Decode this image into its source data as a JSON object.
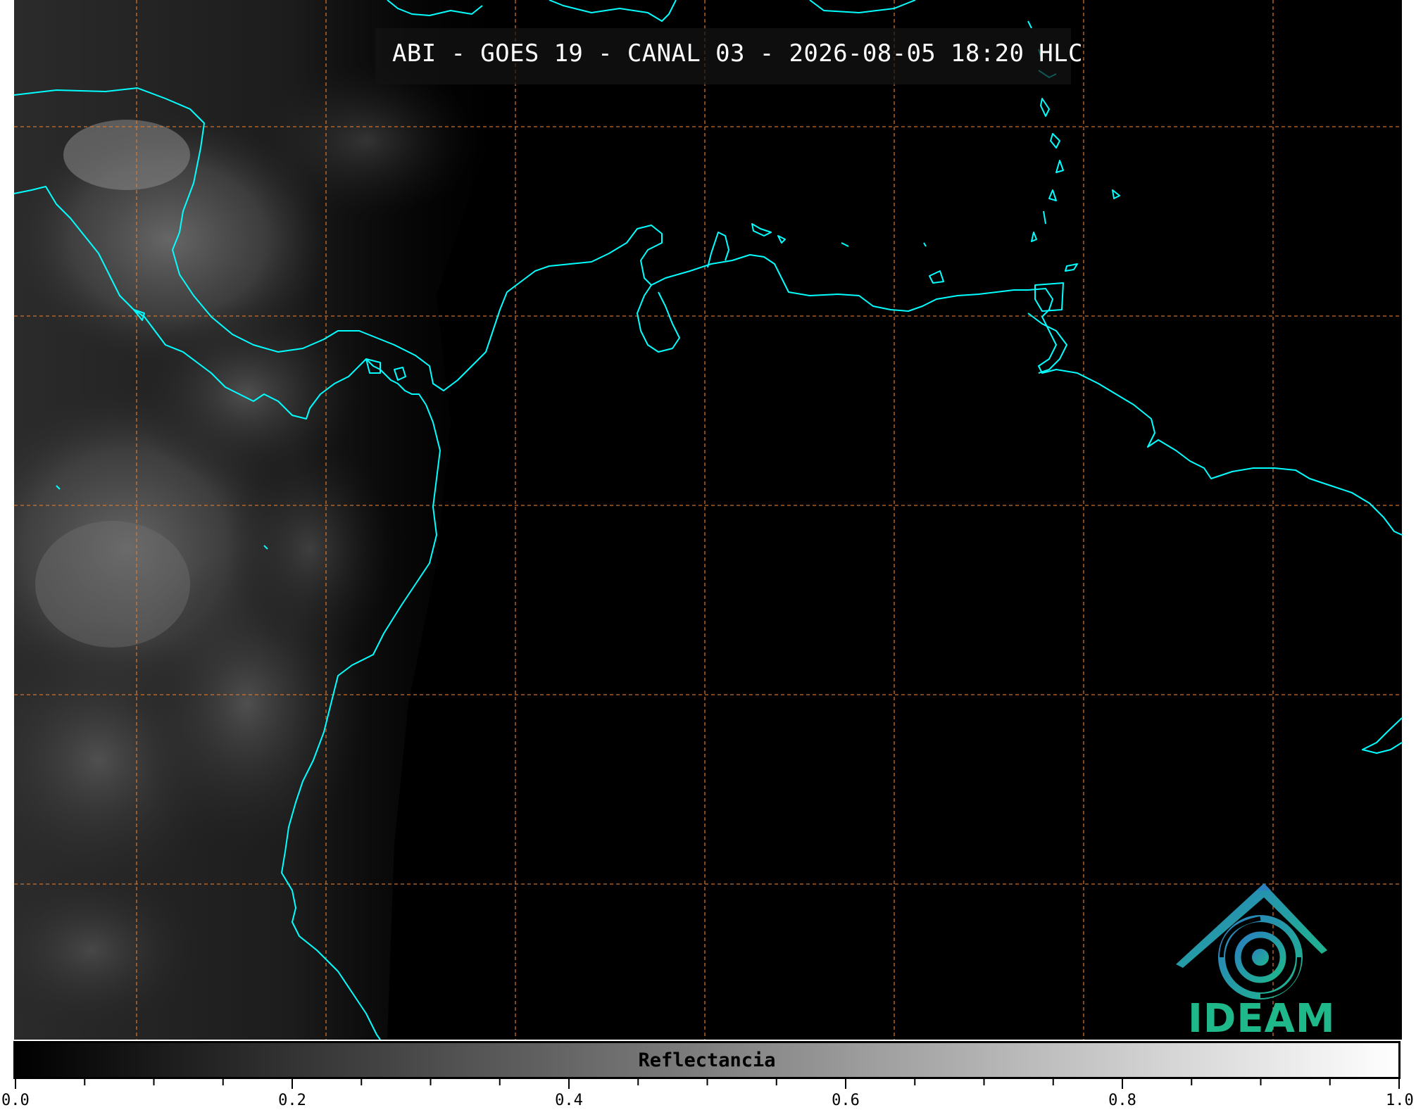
{
  "title": "ABI - GOES 19 - CANAL 03 - 2026-08-05 18:20 HLC",
  "logo": {
    "text": "IDEAM",
    "color": "#1fb88a",
    "accent": "#2a7fc1"
  },
  "colorbar": {
    "label": "Reflectancia",
    "min": 0.0,
    "max": 1.0,
    "major_ticks": [
      "0.0",
      "0.2",
      "0.4",
      "0.6",
      "0.8",
      "1.0"
    ],
    "minor_step": 0.05,
    "colormap": [
      "#000000",
      "#ffffff"
    ]
  },
  "map": {
    "coastline_color": "#00ffff",
    "gridline_color": "#e07a2e",
    "gridline_style": "dashed",
    "background": "#000000"
  }
}
